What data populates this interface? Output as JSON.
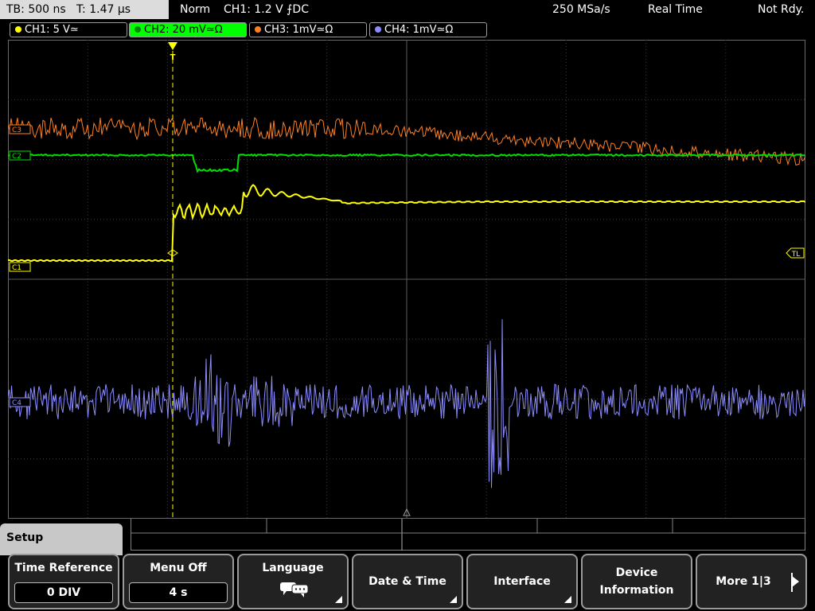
{
  "status": {
    "timebase": "TB: 500 ns",
    "trigger_time": "T: 1.47 µs",
    "mode": "Norm",
    "trigger_setting": "CH1: 1.2 V ⨍DC",
    "sample_rate": "250 MSa/s",
    "acquisition": "Real Time",
    "ready_state": "Not Rdy."
  },
  "channels": [
    {
      "label": "CH1: 5 V≃",
      "color": "#ffff00",
      "active": false
    },
    {
      "label": "CH2: 20 mV≃Ω",
      "color": "#00ff00",
      "active": true
    },
    {
      "label": "CH3: 1mV≃Ω",
      "color": "#ff8020",
      "active": false
    },
    {
      "label": "CH4: 1mV≃Ω",
      "color": "#8c8cff",
      "active": false
    }
  ],
  "markers": {
    "trigger": "T",
    "trigger_level": "TL",
    "ch1": "C1",
    "ch2": "C2",
    "ch3": "C3",
    "ch4": "C4"
  },
  "menu": {
    "title": "Setup",
    "keys": [
      {
        "title": "Time Reference",
        "value": "0 DIV"
      },
      {
        "title": "Menu Off",
        "value": "4 s"
      },
      {
        "title": "Language",
        "icon": "speech-bubbles-icon"
      },
      {
        "title": "Date & Time"
      },
      {
        "title": "Interface"
      },
      {
        "title": "Device Information"
      },
      {
        "title": "More 1|3"
      }
    ]
  },
  "colors": {
    "grid": "#5a5a5a",
    "ch1": "#ffff00",
    "ch2": "#00ff00",
    "ch3": "#ff8020",
    "ch4": "#8c8cff"
  }
}
